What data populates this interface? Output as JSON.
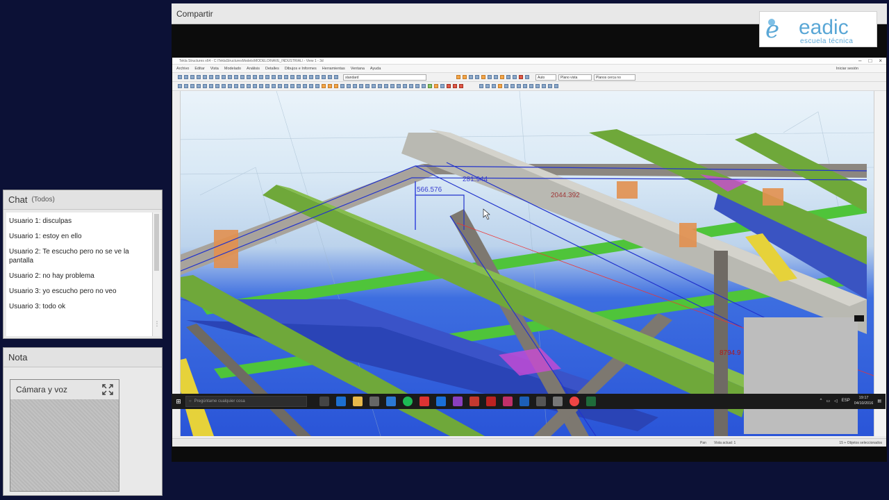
{
  "chat": {
    "title": "Chat",
    "audience": "(Todos)",
    "messages": [
      {
        "user": "Usuario 1",
        "text": "disculpas"
      },
      {
        "user": "Usuario 1",
        "text": "estoy en ello"
      },
      {
        "user": "Usuario 2",
        "text": "Te escucho pero no se ve la pantalla"
      },
      {
        "user": "Usuario 2",
        "text": "no hay problema"
      },
      {
        "user": "Usuario 3",
        "text": "yo escucho pero no veo"
      },
      {
        "user": "Usuario 3",
        "text": "todo ok"
      }
    ]
  },
  "note": {
    "title": "Nota",
    "camera_title": "Cámara y voz",
    "expand_icon": "expand-icon"
  },
  "share": {
    "title": "Compartir",
    "logo": {
      "name": "eadic",
      "tagline": "escuela técnica"
    }
  },
  "tekla": {
    "menu": [
      "Archivo",
      "Editar",
      "Vista",
      "Modelado",
      "Análisis",
      "Detalles",
      "Dibujos e Informes",
      "Herramientas",
      "Ventana",
      "Ayuda"
    ],
    "sign_in": "Iniciar sesión",
    "combo_standard": "standard",
    "combo_auto": "Auto",
    "combo_plane": "Plano vista",
    "combo_snap": "Planos cerca no",
    "dimensions": {
      "d1": "566.576",
      "d2": "281.944",
      "d3": "2044.392",
      "d4": "8794.9"
    },
    "status_view": "Vista actual: 1",
    "status_selected": "15 + Objetos seleccionados",
    "status_p": "Pan"
  },
  "taskbar": {
    "search_placeholder": "Pregúntame cualquier cosa",
    "time": "19:17",
    "date": "04/10/2016",
    "lang": "ESP"
  },
  "colors": {
    "beam_green": "#6fa83a",
    "beam_grey": "#b9b9b2",
    "beam_blue": "#3e5fd1",
    "brace_grey": "#7d7870",
    "selection_blue": "#2233cc",
    "accent_eadic": "#5aa7d6"
  }
}
